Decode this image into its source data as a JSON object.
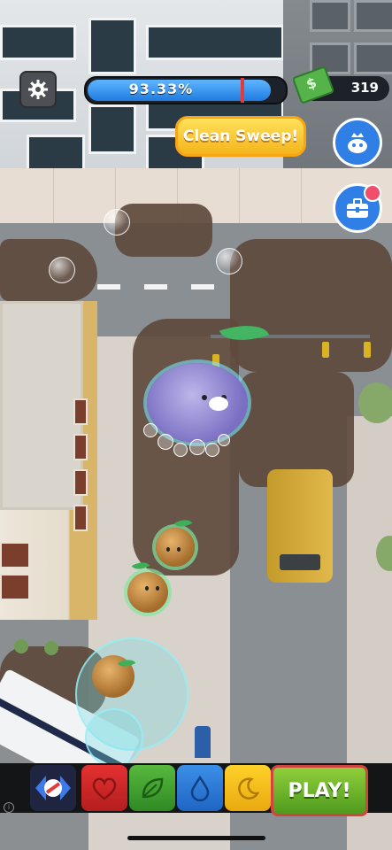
{
  "hud": {
    "progress_label": "93.33%",
    "progress_value": 0.9333,
    "cash": "319",
    "banner": "Clean Sweep!",
    "settings_icon": "gear-icon",
    "crown_icon": "crown-character-icon",
    "tool_icon": "toolbox-icon"
  },
  "toolbar": {
    "items": [
      {
        "name": "swap-arrows-icon",
        "color": "#1f2440"
      },
      {
        "name": "heart-icon",
        "color": "#e43131"
      },
      {
        "name": "leaf-icon",
        "color": "#58b83e"
      },
      {
        "name": "water-drop-icon",
        "color": "#3c8fe6"
      },
      {
        "name": "moon-icon",
        "color": "#ffd12a"
      }
    ],
    "play_label": "PLAY!"
  },
  "colors": {
    "accent_blue": "#2f7fe6",
    "banner_yellow": "#f3b51c",
    "progress_blue": "#1f7be0"
  }
}
